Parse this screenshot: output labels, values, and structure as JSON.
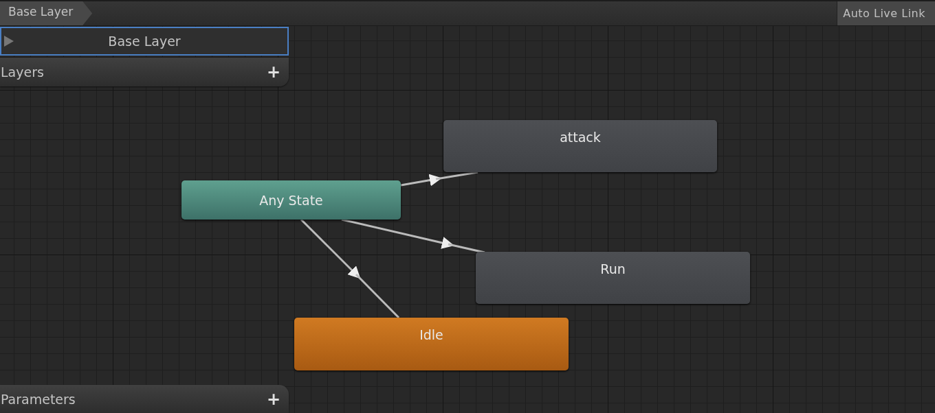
{
  "breadcrumb": {
    "label": "Base Layer"
  },
  "toolbar": {
    "auto_live_link": {
      "label": "Auto Live Link"
    }
  },
  "layers_panel": {
    "layers": [
      {
        "name": "Base Layer",
        "selected": true
      }
    ],
    "title": "Layers",
    "add_label": "+"
  },
  "parameters_panel": {
    "title": "Parameters",
    "add_label": "+"
  },
  "states": [
    {
      "name": "attack",
      "kind": "normal"
    },
    {
      "name": "Any State",
      "kind": "any_state"
    },
    {
      "name": "Run",
      "kind": "normal"
    },
    {
      "name": "Idle",
      "kind": "default"
    }
  ]
}
